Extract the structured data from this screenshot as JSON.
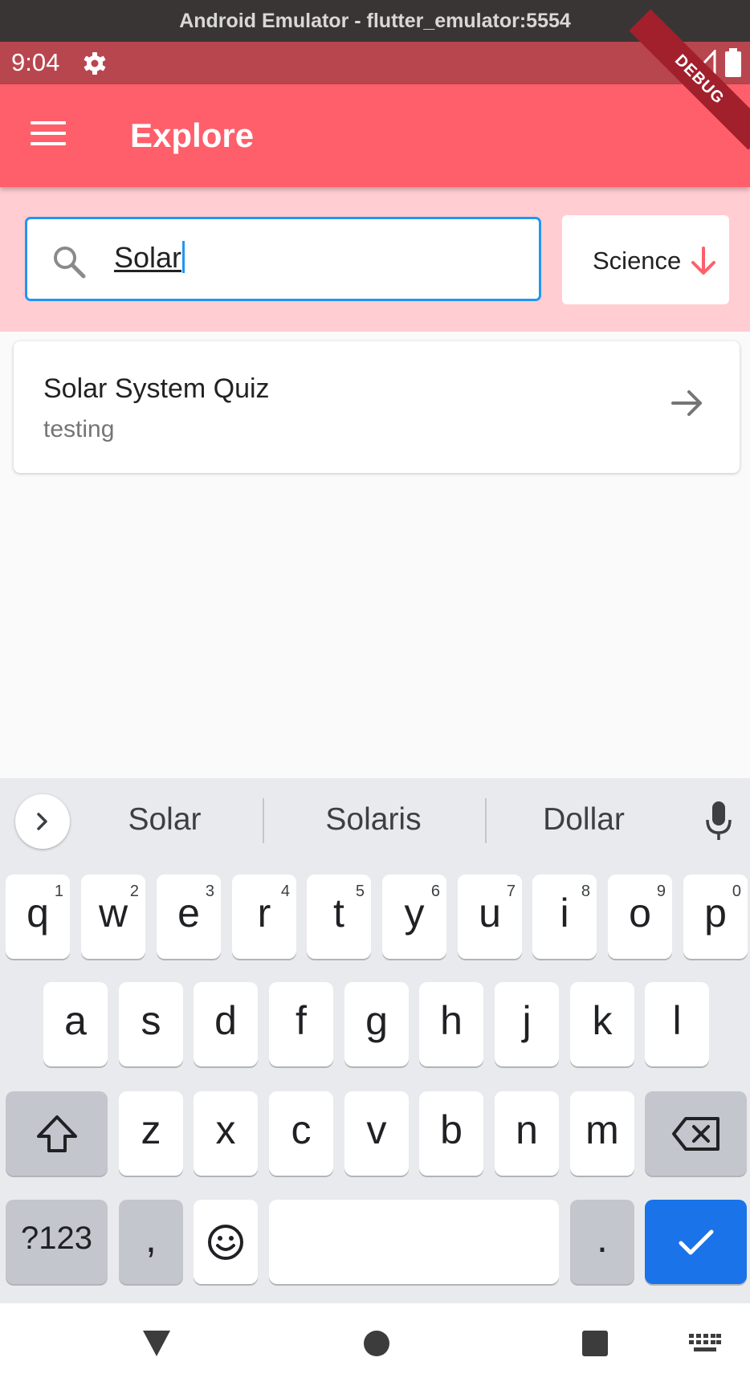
{
  "window": {
    "title": "Android Emulator - flutter_emulator:5554"
  },
  "status_bar": {
    "time": "9:04"
  },
  "debug_banner": "DEBUG",
  "app_bar": {
    "title": "Explore",
    "menu_icon": "hamburger-menu-icon"
  },
  "search": {
    "value": "Solar",
    "icon": "search-icon"
  },
  "category_filter": {
    "label": "Science",
    "icon": "arrow-down-icon"
  },
  "results": [
    {
      "title": "Solar System Quiz",
      "subtitle": "testing",
      "icon": "arrow-forward-icon"
    }
  ],
  "keyboard": {
    "suggestions": [
      "Solar",
      "Solaris",
      "Dollar"
    ],
    "row1": [
      {
        "key": "q",
        "hint": "1"
      },
      {
        "key": "w",
        "hint": "2"
      },
      {
        "key": "e",
        "hint": "3"
      },
      {
        "key": "r",
        "hint": "4"
      },
      {
        "key": "t",
        "hint": "5"
      },
      {
        "key": "y",
        "hint": "6"
      },
      {
        "key": "u",
        "hint": "7"
      },
      {
        "key": "i",
        "hint": "8"
      },
      {
        "key": "o",
        "hint": "9"
      },
      {
        "key": "p",
        "hint": "0"
      }
    ],
    "row2": [
      "a",
      "s",
      "d",
      "f",
      "g",
      "h",
      "j",
      "k",
      "l"
    ],
    "row3": [
      "z",
      "x",
      "c",
      "v",
      "b",
      "n",
      "m"
    ],
    "symbols_key": "?123",
    "comma_key": ",",
    "period_key": "."
  },
  "colors": {
    "app_bar": "#fe5f6b",
    "status_bar": "#b8464e",
    "search_band": "#ffcdd2",
    "focus_border": "#2196f3",
    "enter_key": "#1a73e8"
  }
}
